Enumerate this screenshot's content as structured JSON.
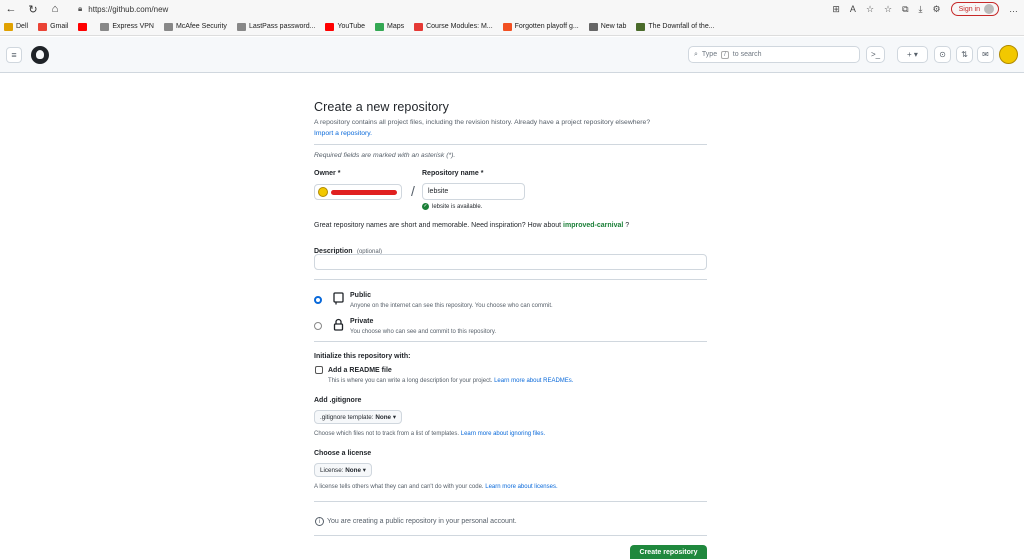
{
  "browser": {
    "url": "https://github.com/new",
    "signin_label": "Sign in"
  },
  "bookmarks": [
    {
      "label": "Dell",
      "color": "#e0a100"
    },
    {
      "label": "Gmail",
      "color": "#ea4335"
    },
    {
      "label": "",
      "color": "#ff0000"
    },
    {
      "label": "Express VPN",
      "color": "#888888"
    },
    {
      "label": "McAfee Security",
      "color": "#888888"
    },
    {
      "label": "LastPass password...",
      "color": "#888888"
    },
    {
      "label": "YouTube",
      "color": "#ff0000"
    },
    {
      "label": "Maps",
      "color": "#34a853"
    },
    {
      "label": "Course Modules: M...",
      "color": "#e53935"
    },
    {
      "label": "Forgotten playoff g...",
      "color": "#f25022"
    },
    {
      "label": "New tab",
      "color": "#666666"
    },
    {
      "label": "The Downfall of the...",
      "color": "#4a6b2a"
    }
  ],
  "header": {
    "search_placeholder": "Type",
    "search_key": "/",
    "search_suffix": "to search",
    "plus_label": "+ ▾"
  },
  "form": {
    "title": "Create a new repository",
    "intro": "A repository contains all project files, including the revision history. Already have a project repository elsewhere?",
    "import_link": "Import a repository.",
    "required_note": "Required fields are marked with an asterisk (*).",
    "owner_label": "Owner *",
    "repo_name_label": "Repository name *",
    "repo_name_value": "lebsite",
    "slash": "/",
    "available_msg": "lebsite is available.",
    "inspiration_text": "Great repository names are short and memorable. Need inspiration? How about",
    "suggestion": "improved-carnival",
    "suggestion_end": "?",
    "description_label": "Description",
    "description_optional": "(optional)",
    "description_value": "",
    "visibility": [
      {
        "title": "Public",
        "desc": "Anyone on the internet can see this repository. You choose who can commit.",
        "checked": true
      },
      {
        "title": "Private",
        "desc": "You choose who can see and commit to this repository.",
        "checked": false
      }
    ],
    "init_heading": "Initialize this repository with:",
    "readme_label": "Add a README file",
    "readme_desc": "This is where you can write a long description for your project.",
    "readme_link": "Learn more about READMEs.",
    "gitignore_heading": "Add .gitignore",
    "gitignore_prefix": ".gitignore template:",
    "gitignore_value": "None",
    "gitignore_desc": "Choose which files not to track from a list of templates.",
    "gitignore_link": "Learn more about ignoring files.",
    "license_heading": "Choose a license",
    "license_prefix": "License:",
    "license_value": "None",
    "license_desc": "A license tells others what they can and can't do with your code.",
    "license_link": "Learn more about licenses.",
    "public_notice": "You are creating a public repository in your personal account.",
    "create_label": "Create repository"
  }
}
